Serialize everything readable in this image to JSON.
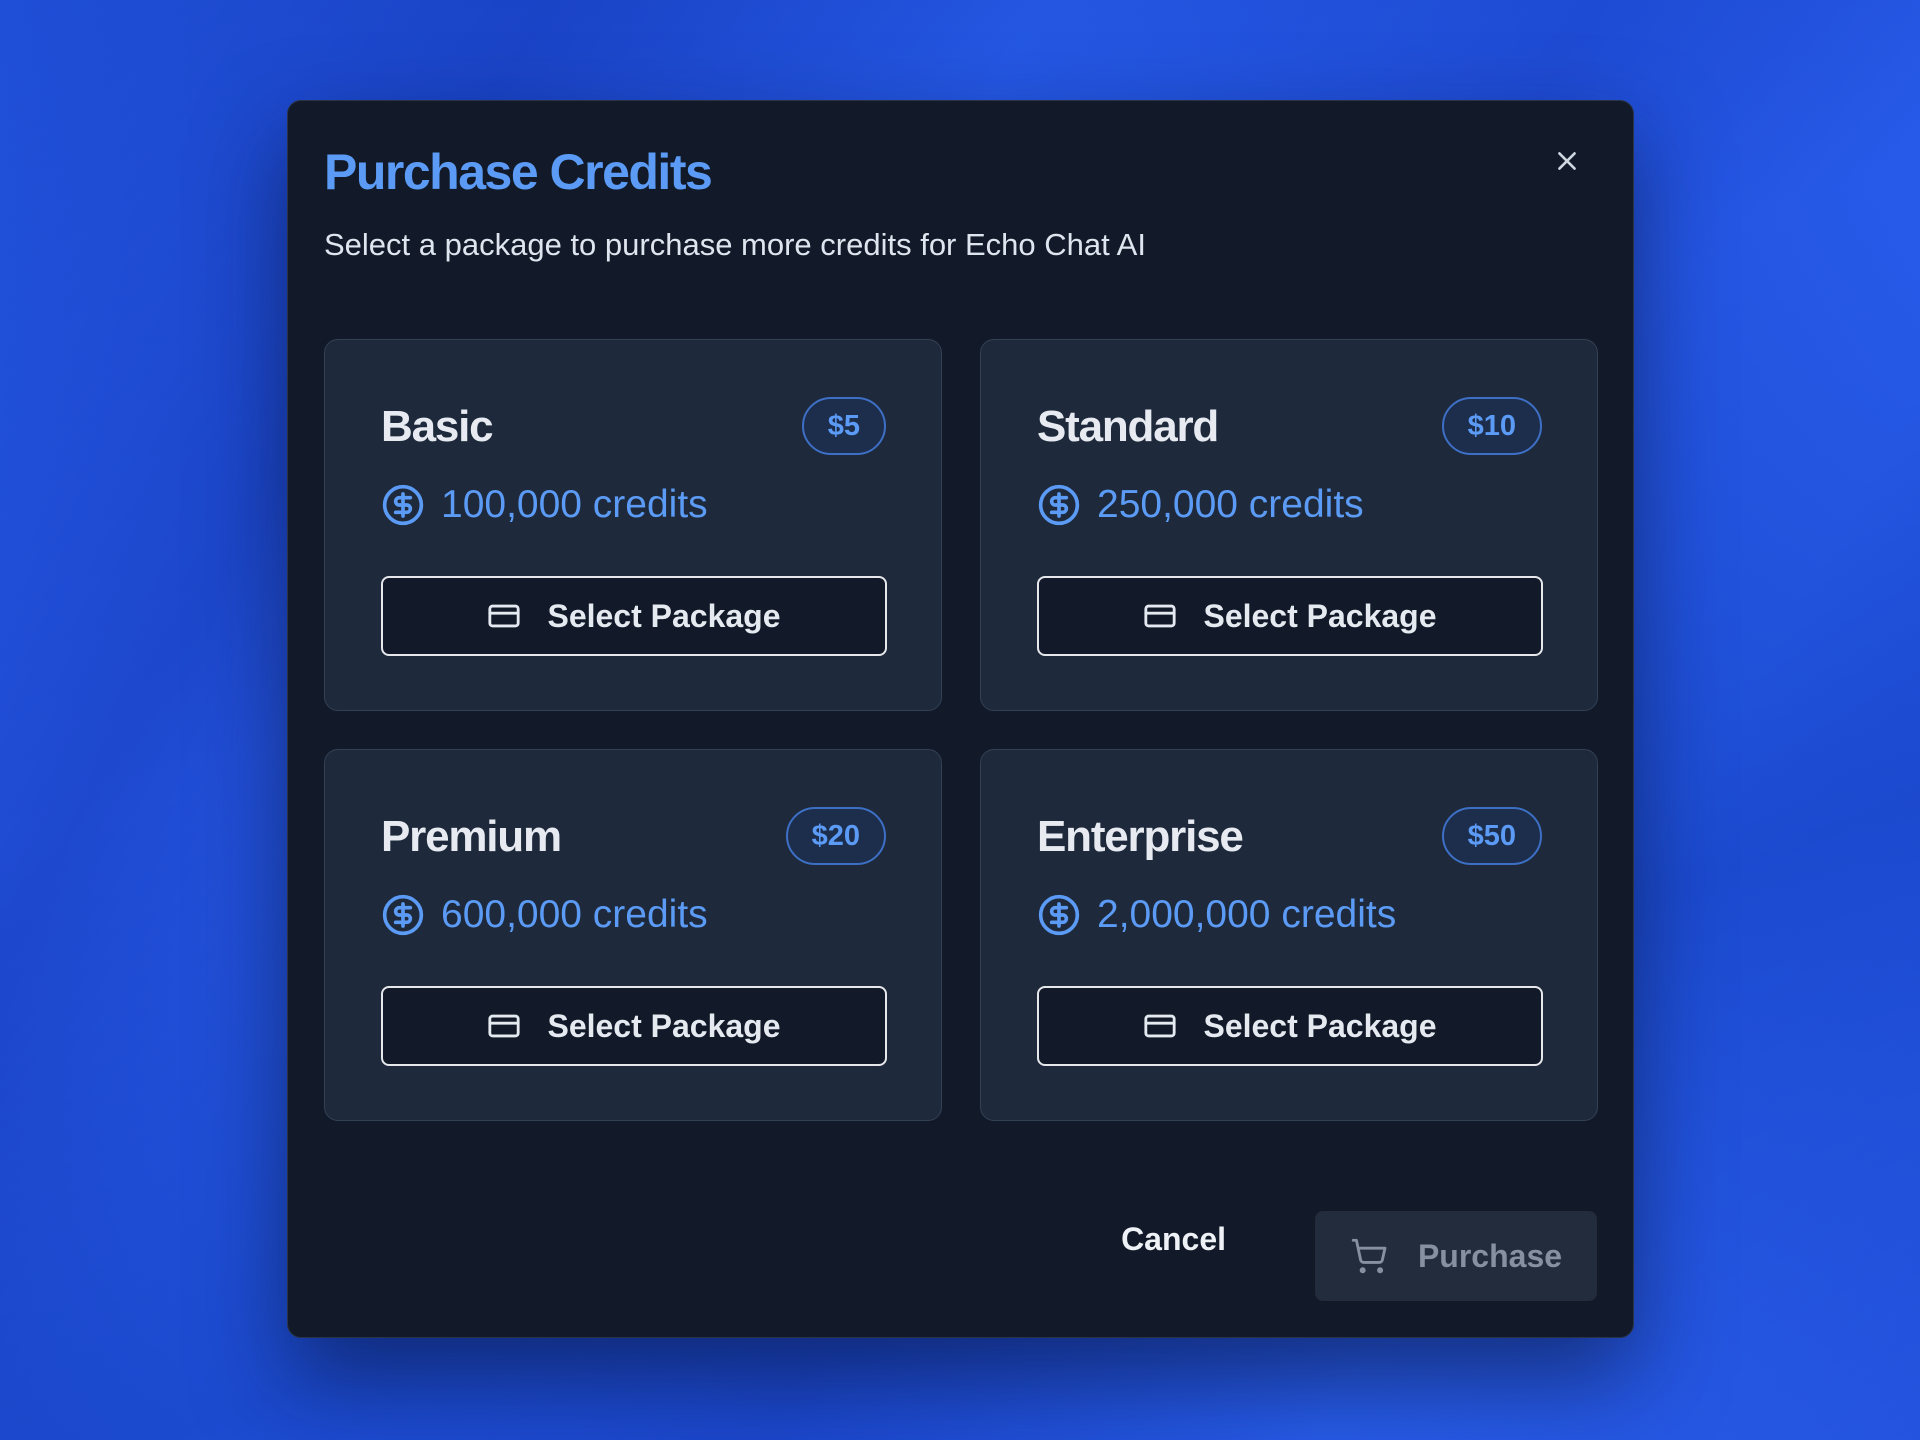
{
  "dialog": {
    "title": "Purchase Credits",
    "subtitle": "Select a package to purchase more credits for Echo Chat AI",
    "close_icon": "close-icon"
  },
  "packages": [
    {
      "name": "Basic",
      "price": "$5",
      "credits": "100,000 credits",
      "button_label": "Select Package"
    },
    {
      "name": "Standard",
      "price": "$10",
      "credits": "250,000 credits",
      "button_label": "Select Package"
    },
    {
      "name": "Premium",
      "price": "$20",
      "credits": "600,000 credits",
      "button_label": "Select Package"
    },
    {
      "name": "Enterprise",
      "price": "$50",
      "credits": "2,000,000 credits",
      "button_label": "Select Package"
    }
  ],
  "footer": {
    "cancel_label": "Cancel",
    "purchase_label": "Purchase",
    "purchase_icon": "cart-icon"
  },
  "colors": {
    "accent": "#5b9bf5",
    "modal_bg": "#121a29",
    "card_bg": "#1e293b",
    "backdrop": "#2a5ff0"
  }
}
